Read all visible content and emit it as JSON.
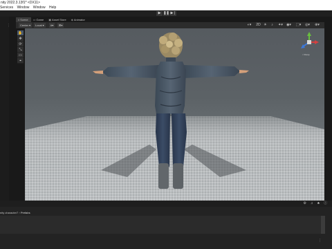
{
  "window": {
    "title": "nity 2022.3.13f1* <DX11>"
  },
  "menu": {
    "items": [
      "Services",
      "Window",
      "Window",
      "Help"
    ]
  },
  "play_controls": {
    "play": "▶",
    "pause": "❚❚",
    "step": "▶❘"
  },
  "tabs": [
    {
      "label": "Scene",
      "icon": "#"
    },
    {
      "label": "Game",
      "icon": "▭"
    },
    {
      "label": "Asset Store",
      "icon": "▣"
    },
    {
      "label": "Animator",
      "icon": "◈"
    }
  ],
  "scene_toolbar": {
    "left": [
      "Center ▾",
      "Local ▾",
      "#▾",
      "⊞▾"
    ],
    "right": [
      "◐▾",
      "2D",
      "☀",
      "♪",
      "✦▾",
      "◉▾",
      "⬚▾",
      "◎▾",
      "⊕▾"
    ]
  },
  "viewport_tools": [
    "✋",
    "✥",
    "⟳",
    "⤡",
    "▭",
    "⌖"
  ],
  "gizmo": {
    "label": "< Persp"
  },
  "breadcrumb": {
    "parent": "nity character7",
    "separator": "›",
    "current": "Prefabs"
  },
  "lower_icons": [
    "⚙",
    "♫",
    "♣",
    "ⓘ"
  ],
  "colors": {
    "titlebar": "#ffffff",
    "editor_bg": "#191919",
    "active_tab": "#3c3c3c",
    "gizmo_x": "#d34040",
    "gizmo_y": "#6abf3f",
    "gizmo_z": "#3d78d8"
  }
}
